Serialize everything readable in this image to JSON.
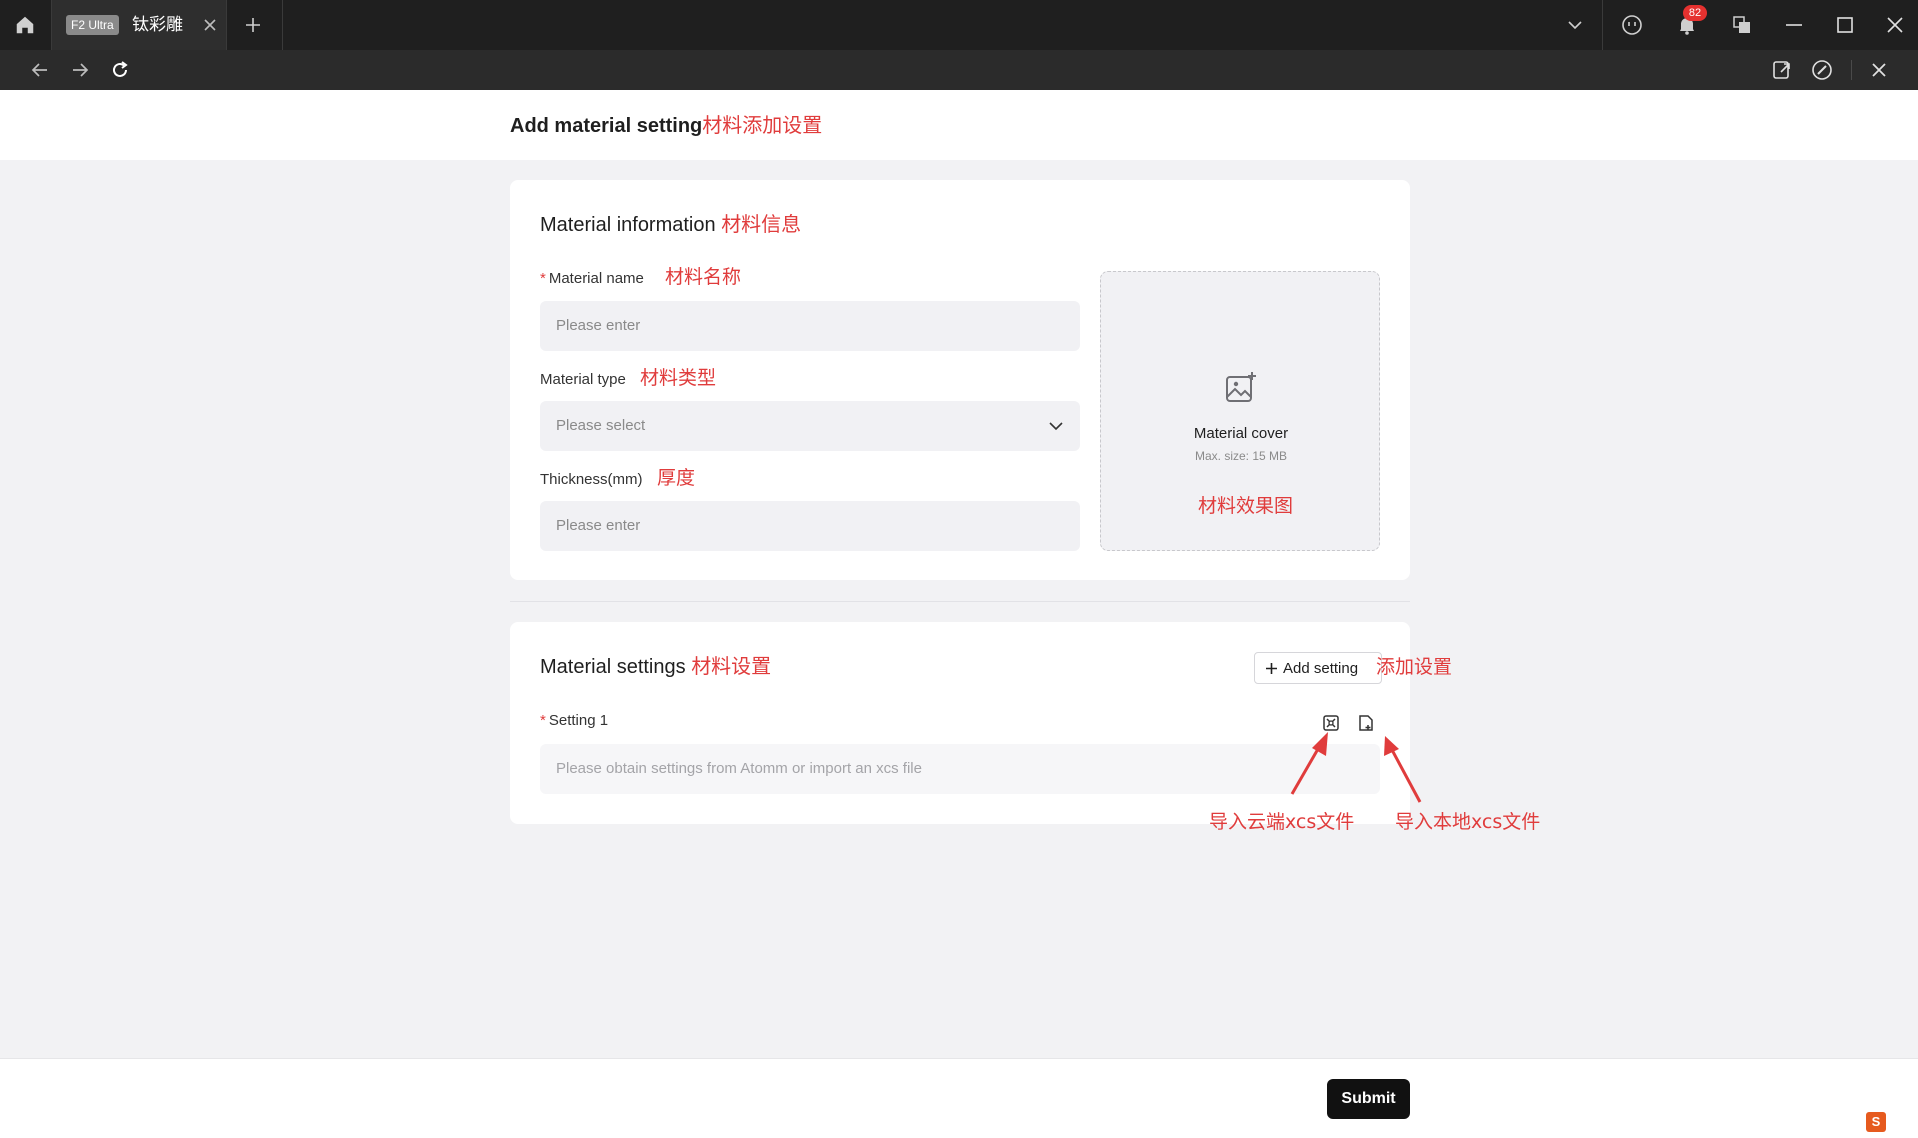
{
  "titlebar": {
    "tab_badge": "F2 Ultra",
    "tab_title": "钛彩雕",
    "notification_count": "82"
  },
  "page": {
    "title": "Add material setting",
    "title_annotation": "材料添加设置"
  },
  "material_info": {
    "section_title": "Material information",
    "section_annotation": "材料信息",
    "name_label": "Material name",
    "name_annotation": "材料名称",
    "name_placeholder": "Please enter",
    "type_label": "Material type",
    "type_annotation": "材料类型",
    "type_placeholder": "Please select",
    "thickness_label": "Thickness(mm)",
    "thickness_annotation": "厚度",
    "thickness_placeholder": "Please enter",
    "cover_label": "Material cover",
    "cover_sub": "Max. size: 15 MB",
    "cover_annotation": "材料效果图"
  },
  "material_settings": {
    "section_title": "Material settings",
    "section_annotation": "材料设置",
    "add_button": "Add setting",
    "add_annotation": "添加设置",
    "setting_label": "Setting 1",
    "setting_placeholder": "Please obtain settings from Atomm or import an xcs file",
    "cloud_import_annotation": "导入云端xcs文件",
    "local_import_annotation": "导入本地xcs文件"
  },
  "footer": {
    "submit": "Submit"
  },
  "colors": {
    "annotation_red": "#e03c3c",
    "titlebar_bg": "#1f1f1f",
    "submit_bg": "#111111"
  }
}
